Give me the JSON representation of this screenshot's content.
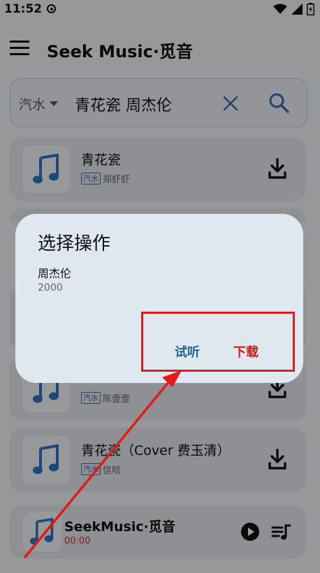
{
  "status_bar": {
    "time": "11:52"
  },
  "app_bar": {
    "title": "Seek Music·觅音"
  },
  "search": {
    "source": "汽水",
    "query": "青花瓷 周杰伦"
  },
  "songs": [
    {
      "title": "青花瓷",
      "source": "汽水",
      "artist": "郑虾虾"
    },
    {
      "title": "",
      "source": "汽水",
      "artist": "陈壹壹"
    },
    {
      "title": "青花瓷（Cover 费玉清）",
      "source": "汽水",
      "artist": "信晗"
    }
  ],
  "player": {
    "title": "SeekMusic·觅音",
    "time": "00:00"
  },
  "dialog": {
    "title": "选择操作",
    "artist": "周杰伦",
    "year": "2000",
    "listen_label": "试听",
    "download_label": "下载"
  },
  "colors": {
    "accent": "#1f6a8a",
    "download": "#c91c1c",
    "annotation": "#e01b1b",
    "badge": "#4a5fc9"
  }
}
